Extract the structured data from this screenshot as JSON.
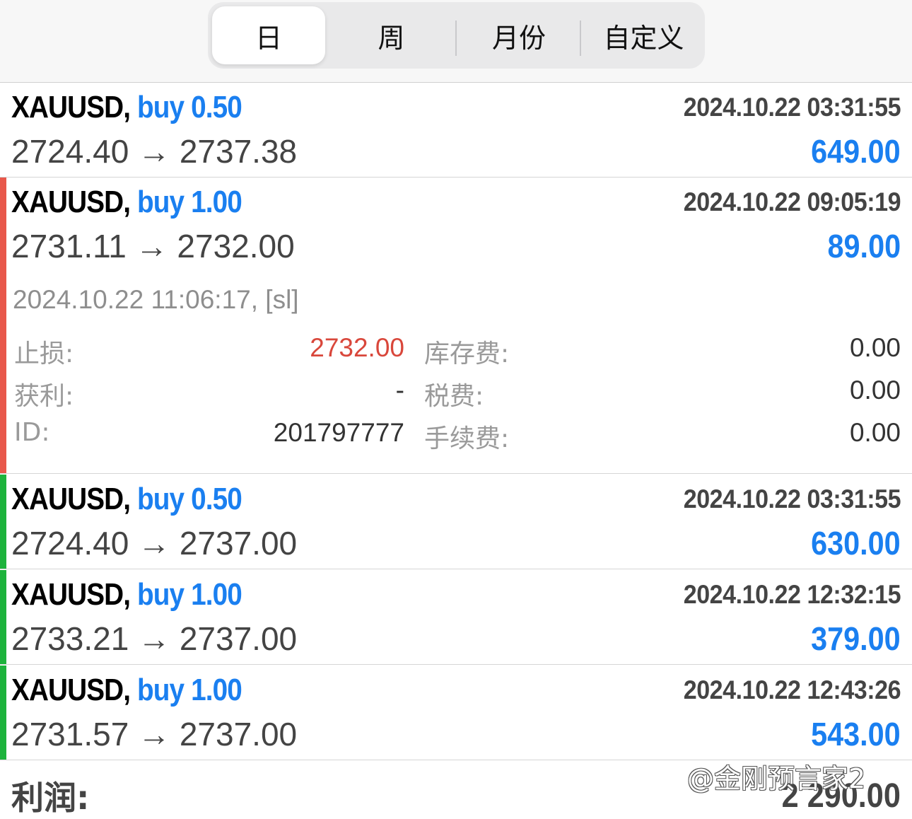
{
  "tabs": [
    {
      "label": "日",
      "active": true
    },
    {
      "label": "周",
      "active": false
    },
    {
      "label": "月份",
      "active": false
    },
    {
      "label": "自定义",
      "active": false
    }
  ],
  "trades": [
    {
      "symbol": "XAUUSD,",
      "action": "buy 0.50",
      "prices": "2724.40 → 2737.38",
      "time": "2024.10.22 03:31:55",
      "profit": "649.00"
    },
    {
      "symbol": "XAUUSD,",
      "action": "buy 1.00",
      "prices": "2731.11 → 2732.00",
      "time": "2024.10.22 09:05:19",
      "profit": "89.00",
      "details": {
        "close_info": "2024.10.22 11:06:17, [sl]",
        "sl_label": "止损:",
        "sl_value": "2732.00",
        "tp_label": "获利:",
        "tp_value": "-",
        "id_label": "ID:",
        "id_value": "201797777",
        "swap_label": "库存费:",
        "swap_value": "0.00",
        "tax_label": "税费:",
        "tax_value": "0.00",
        "fee_label": "手续费:",
        "fee_value": "0.00"
      }
    },
    {
      "symbol": "XAUUSD,",
      "action": "buy 0.50",
      "prices": "2724.40 → 2737.00",
      "time": "2024.10.22 03:31:55",
      "profit": "630.00"
    },
    {
      "symbol": "XAUUSD,",
      "action": "buy 1.00",
      "prices": "2733.21 → 2737.00",
      "time": "2024.10.22 12:32:15",
      "profit": "379.00"
    },
    {
      "symbol": "XAUUSD,",
      "action": "buy 1.00",
      "prices": "2731.57 → 2737.00",
      "time": "2024.10.22 12:43:26",
      "profit": "543.00"
    }
  ],
  "summary": {
    "label": "利润:",
    "value": "2 290.00"
  },
  "watermark": "@金刚预言家2",
  "colors": {
    "accent_blue": "#1a7ff0",
    "loss_marker": "#e8584b",
    "profit_marker": "#1db33c",
    "sl_red": "#d9473b"
  }
}
